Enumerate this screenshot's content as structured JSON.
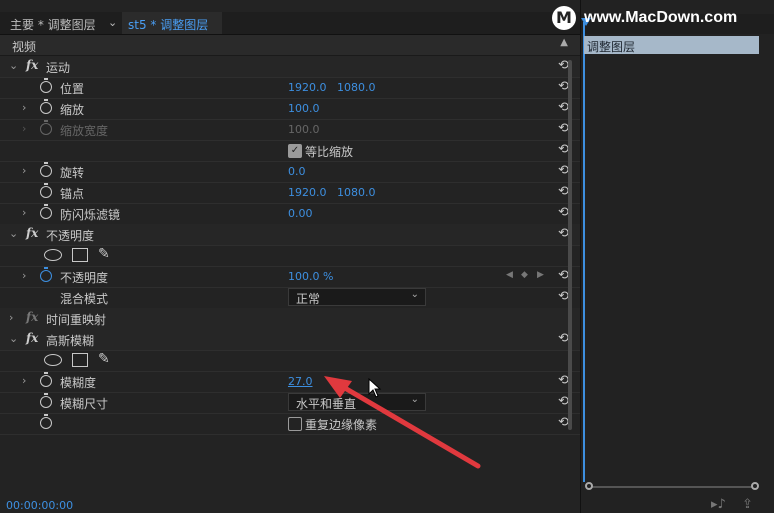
{
  "tabs": {
    "first": "主要 * 调整图层",
    "separator": "⌄",
    "active": "st5 * 调整图层"
  },
  "video_header": "视频",
  "sections": {
    "motion": "运动",
    "opacity": "不透明度",
    "time_remap": "时间重映射",
    "gaussian": "高斯模糊"
  },
  "params": {
    "position": {
      "label": "位置",
      "x": "1920.0",
      "y": "1080.0"
    },
    "scale": {
      "label": "缩放",
      "value": "100.0"
    },
    "scale_width": {
      "label": "缩放宽度",
      "value": "100.0"
    },
    "uniform_scale": {
      "label": "等比缩放",
      "checked": true
    },
    "rotation": {
      "label": "旋转",
      "value": "0.0"
    },
    "anchor": {
      "label": "锚点",
      "x": "1920.0",
      "y": "1080.0"
    },
    "flicker": {
      "label": "防闪烁滤镜",
      "value": "0.00"
    },
    "opacity": {
      "label": "不透明度",
      "value": "100.0 %"
    },
    "blend": {
      "label": "混合模式",
      "value": "正常"
    },
    "blurriness": {
      "label": "模糊度",
      "value": "27.0"
    },
    "blur_dims": {
      "label": "模糊尺寸",
      "value": "水平和垂直"
    },
    "repeat_edge": {
      "label": "重复边缘像素",
      "checked": false
    }
  },
  "timecode": "00:00:00:00",
  "timeline": {
    "clip_label": "调整图层"
  },
  "watermark": {
    "text": "www.MacDown.com",
    "logo": "M"
  },
  "colors": {
    "accent": "#3d8fe0",
    "clip": "#a6b8c9",
    "arrow": "#e0393e"
  }
}
